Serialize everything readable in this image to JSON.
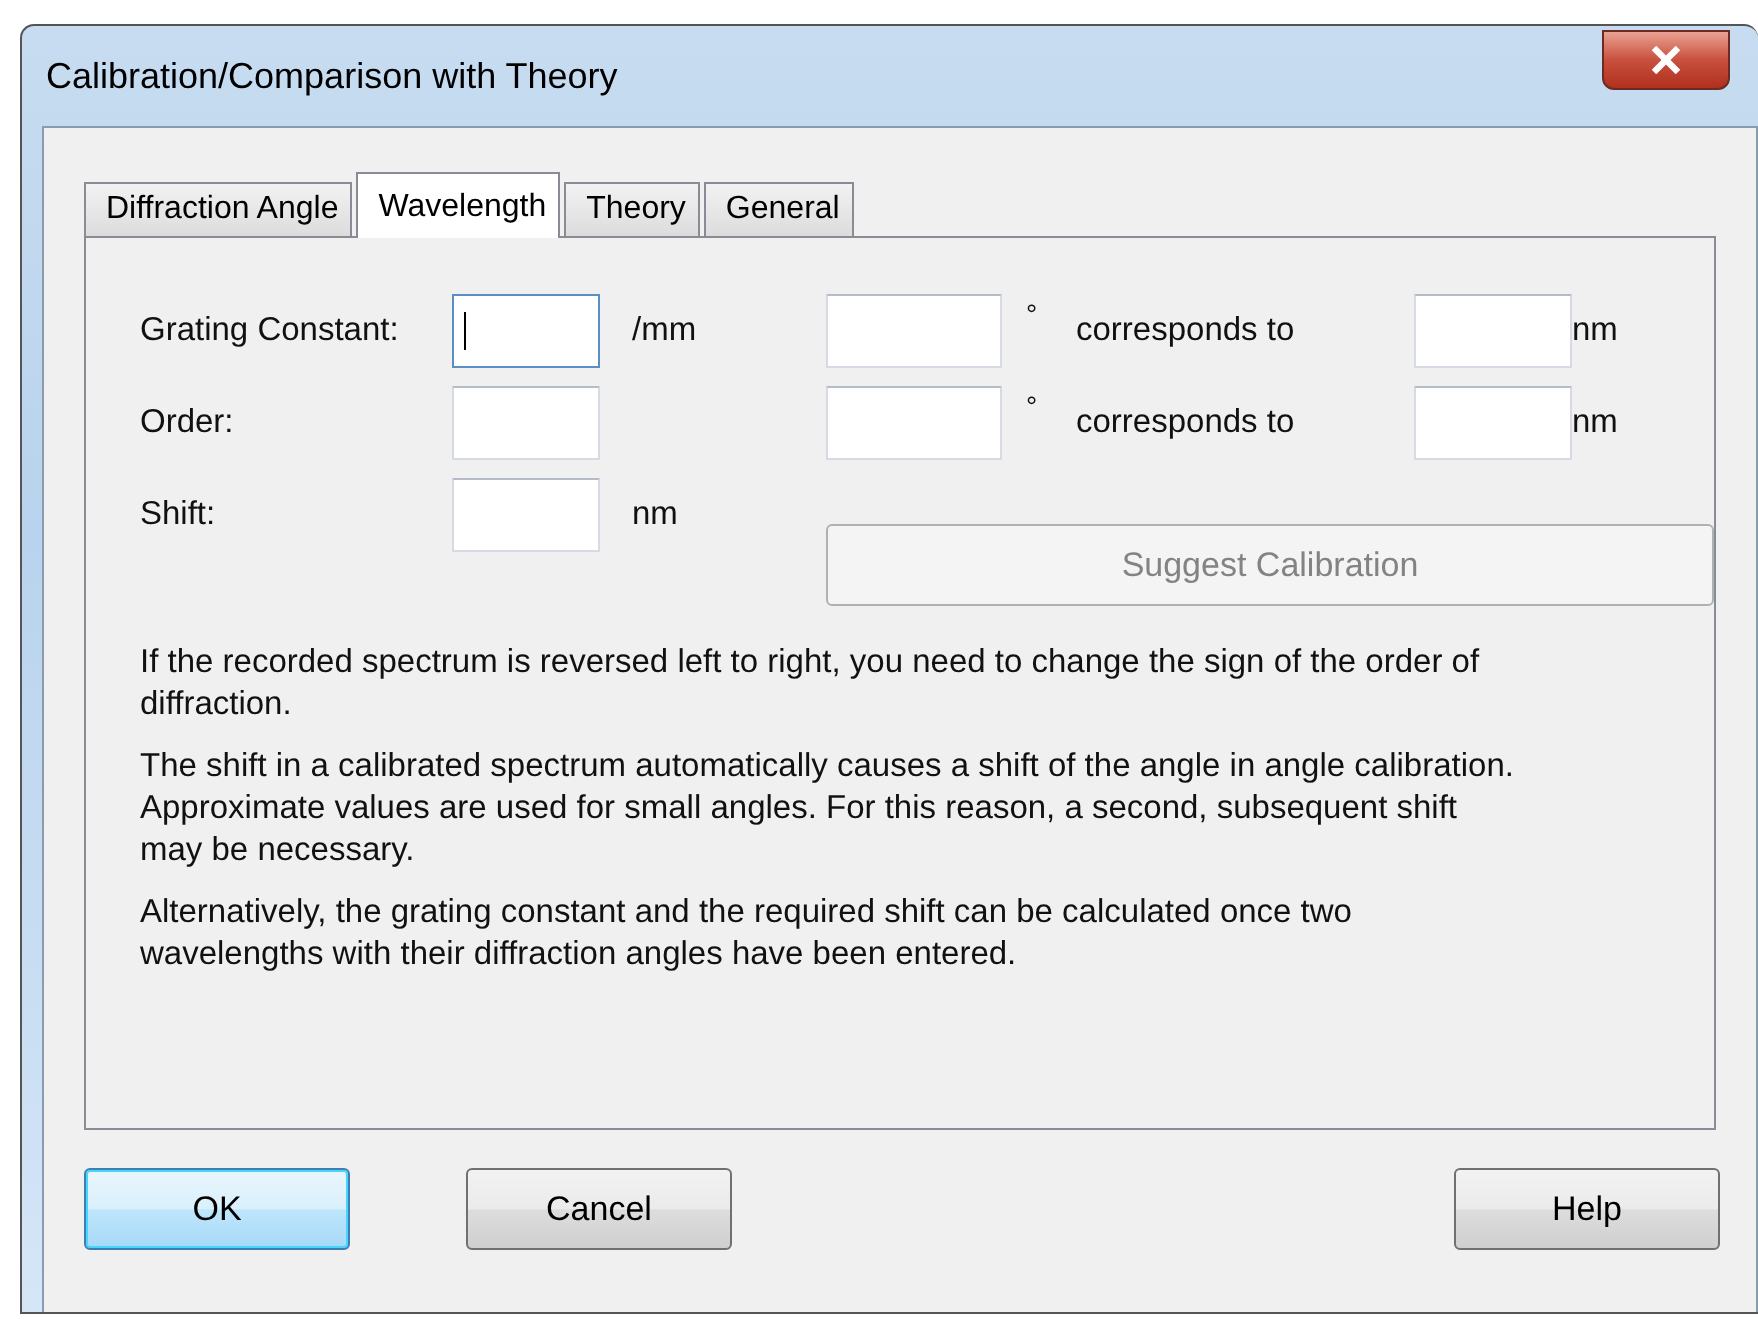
{
  "window": {
    "title": "Calibration/Comparison with Theory"
  },
  "tabs": [
    {
      "label": "Diffraction Angle",
      "selected": false
    },
    {
      "label": "Wavelength",
      "selected": true
    },
    {
      "label": "Theory",
      "selected": false
    },
    {
      "label": "General",
      "selected": false
    }
  ],
  "form": [
    {
      "label": "Grating Constant:",
      "unit": "/mm",
      "focused": true
    },
    {
      "label": "Order:",
      "focused": false
    },
    {
      "label": "Shift:",
      "unit": "nm",
      "focused": false
    }
  ],
  "calibration_rows": [
    {
      "degree": "°",
      "connector": "corresponds to",
      "unit": "nm"
    },
    {
      "degree": "°",
      "connector": "corresponds to",
      "unit": "nm"
    }
  ],
  "suggest_button": {
    "label": "Suggest Calibration",
    "disabled": true
  },
  "notes": [
    "If the recorded spectrum is reversed left to right, you need to change the sign of the order of diffraction.",
    "The shift in a calibrated spectrum automatically causes a shift of the angle in angle calibration. Approximate values are used for small angles. For this reason, a second, subsequent shift may be necessary.",
    "Alternatively, the grating constant and the required shift can be calculated once two wavelengths with their diffraction angles have been entered."
  ],
  "buttons": [
    {
      "label": "OK",
      "default": true
    },
    {
      "label": "Cancel",
      "default": false
    },
    {
      "label": "Help",
      "default": false
    }
  ]
}
